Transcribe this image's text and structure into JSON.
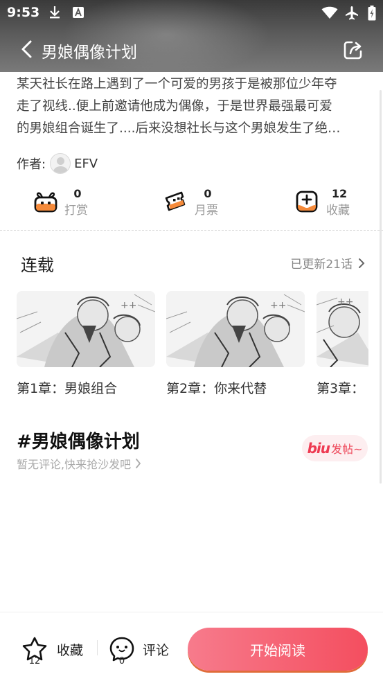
{
  "status_bar": {
    "time": "9:53"
  },
  "nav": {
    "title": "男娘偶像计划"
  },
  "description": {
    "lines": [
      "某天社长在路上遇到了一个可爱的男孩于是被那位少年夺",
      "走了视线..便上前邀请他成为偶像，于是世界最强最可爱",
      "的男娘组合诞生了....后来没想社长与这个男娘发生了绝…"
    ]
  },
  "author": {
    "label": "作者:",
    "name": "EFV"
  },
  "stats": [
    {
      "icon": "gift-icon",
      "count": "0",
      "label": "打赏"
    },
    {
      "icon": "ticket-icon",
      "count": "0",
      "label": "月票"
    },
    {
      "icon": "favorite-box-icon",
      "count": "12",
      "label": "收藏"
    }
  ],
  "serial": {
    "title": "连载",
    "update_text": "已更新21话"
  },
  "chapters": [
    {
      "label": "第1章：男娘组合"
    },
    {
      "label": "第2章：你来代替"
    },
    {
      "label": "第3章："
    }
  ],
  "topic": {
    "title": "#男娘偶像计划",
    "empty_text": "暂无评论,快来抢沙发吧",
    "post_logo": "biu",
    "post_label": "发帖~"
  },
  "bottom_bar": {
    "favorite": {
      "label": "收藏",
      "count": "12"
    },
    "comment": {
      "label": "评论",
      "count": "0"
    },
    "read_button": "开始阅读"
  },
  "colors": {
    "accent": "#f44e5f",
    "accent_light": "#f77b8c",
    "header_bg": "#5a5a5a"
  }
}
